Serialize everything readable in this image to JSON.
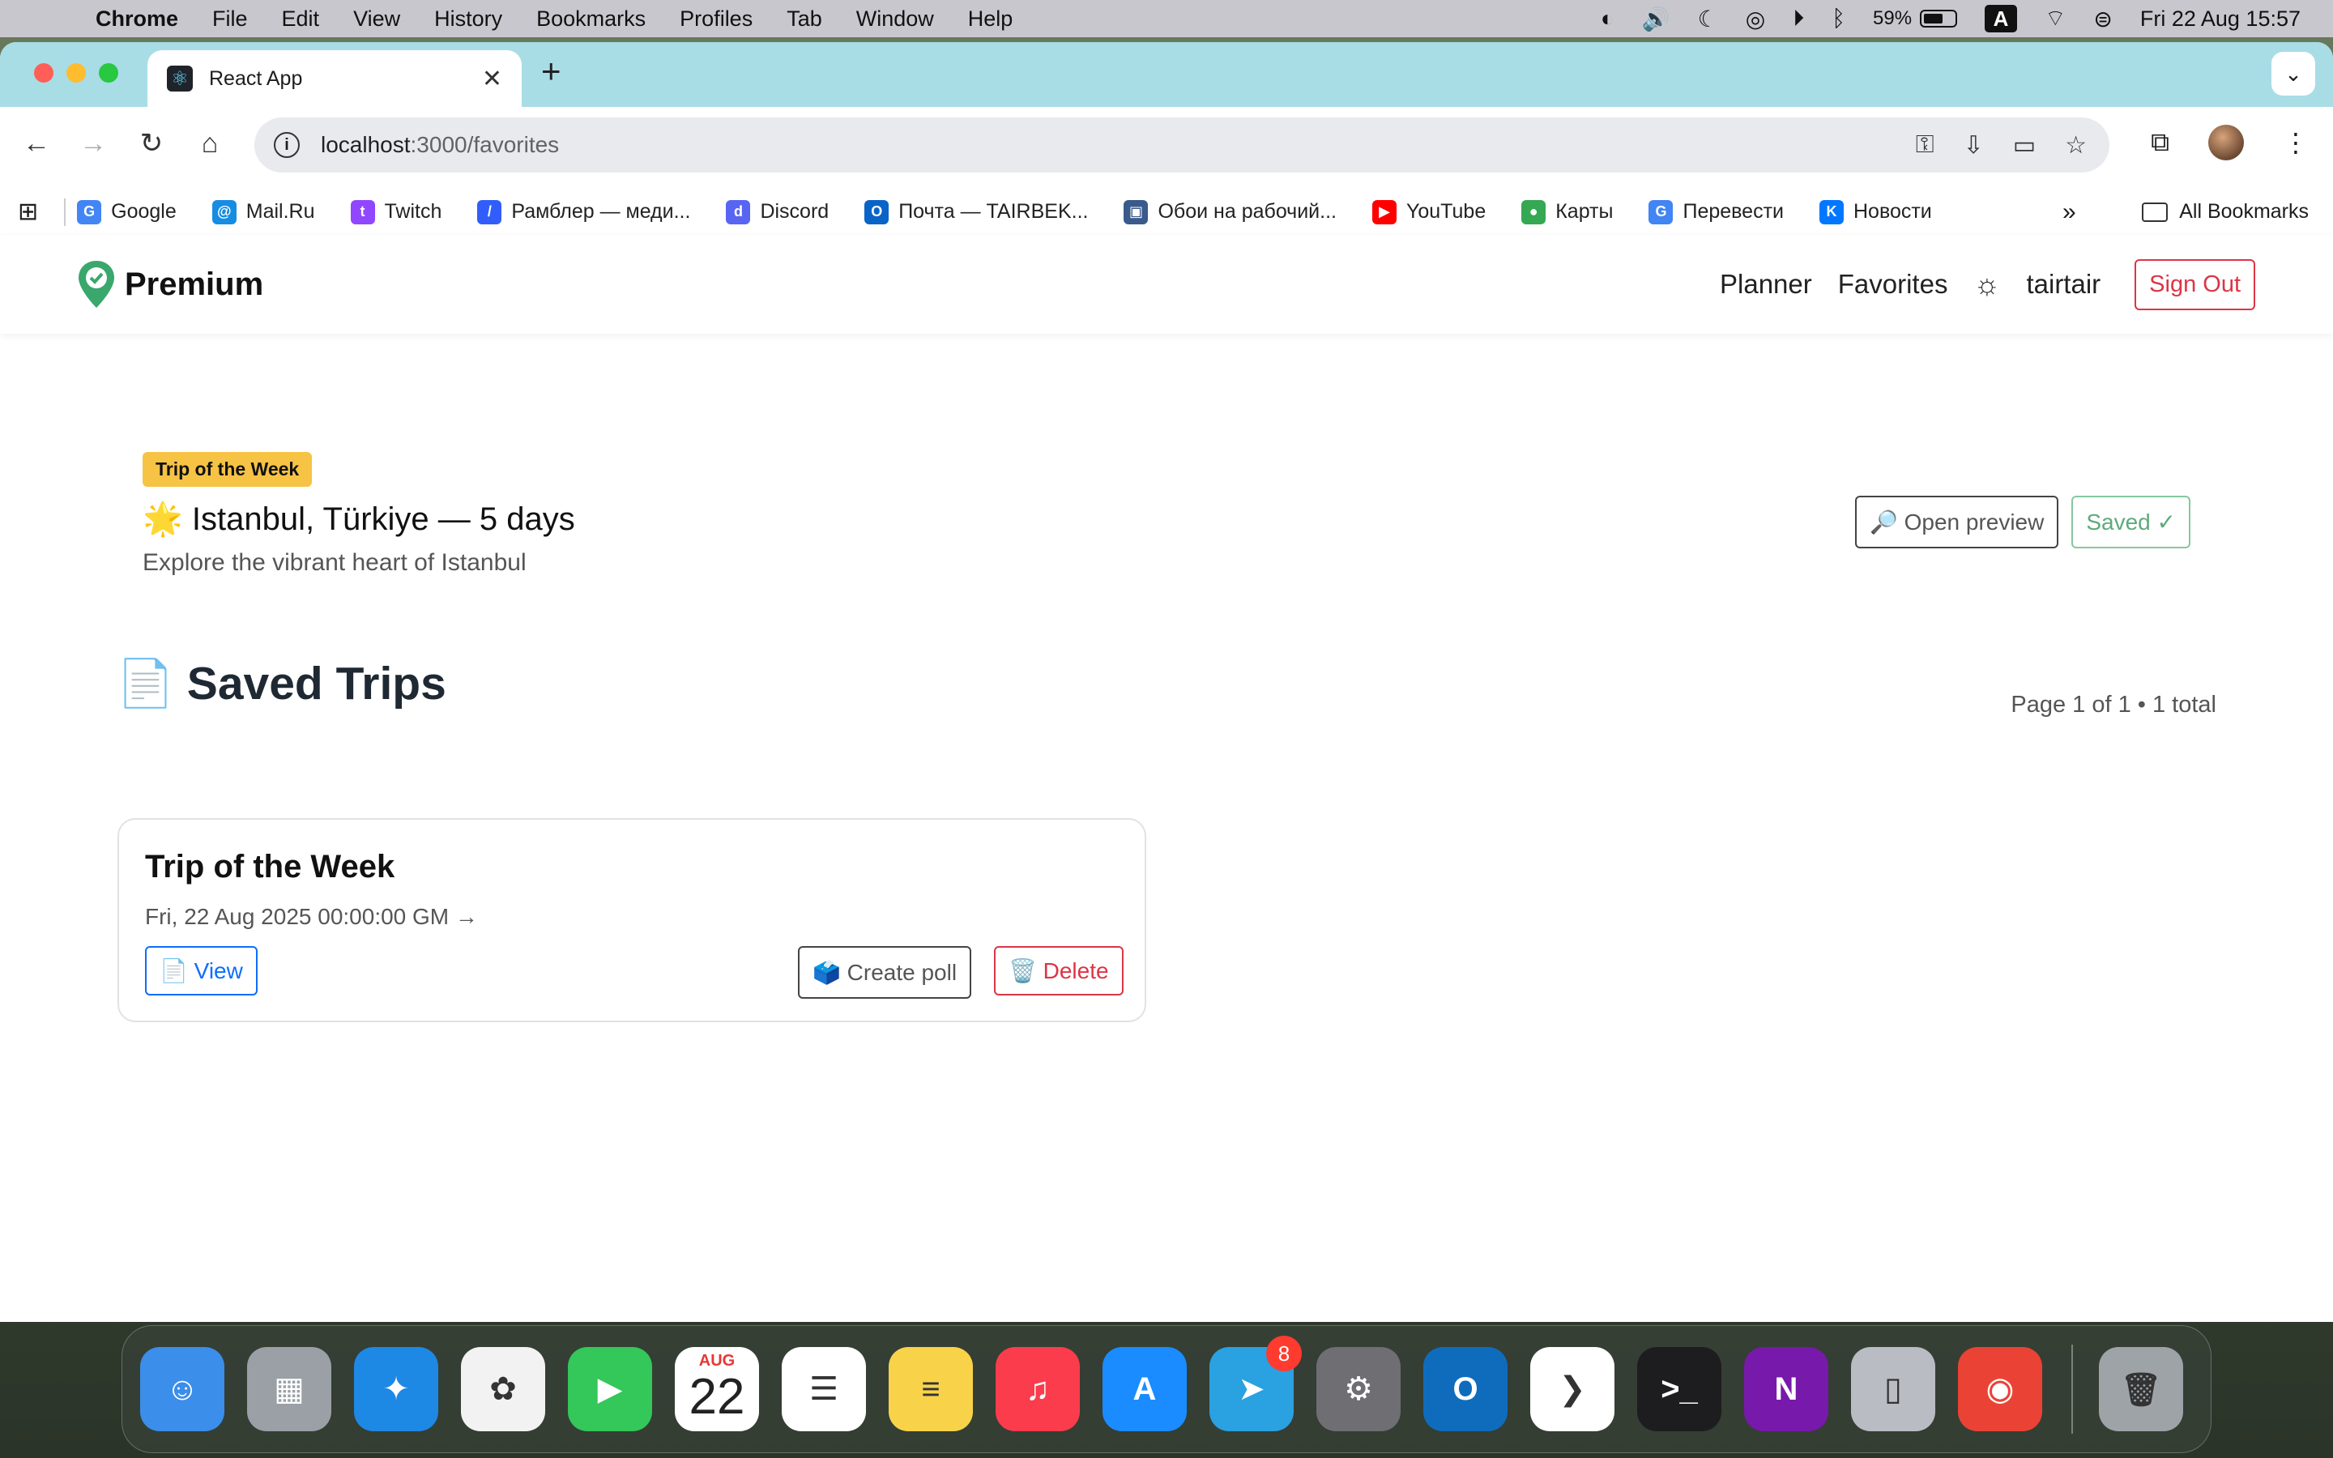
{
  "menubar": {
    "app": "Chrome",
    "items": [
      "File",
      "Edit",
      "View",
      "History",
      "Bookmarks",
      "Profiles",
      "Tab",
      "Window",
      "Help"
    ],
    "battery": "59%",
    "input_source": "A",
    "datetime": "Fri 22 Aug  15:57"
  },
  "browser": {
    "tab_title": "React App",
    "url_host": "localhost",
    "url_path": ":3000/favorites",
    "bookmarks": [
      {
        "label": "Google",
        "icon": "google-icon",
        "color": "#4285f4",
        "glyph": "G"
      },
      {
        "label": "Mail.Ru",
        "icon": "mailru-icon",
        "color": "#168de2",
        "glyph": "@"
      },
      {
        "label": "Twitch",
        "icon": "twitch-icon",
        "color": "#9146ff",
        "glyph": "t"
      },
      {
        "label": "Рамблер — меди...",
        "icon": "rambler-icon",
        "color": "#315efb",
        "glyph": "/"
      },
      {
        "label": "Discord",
        "icon": "discord-icon",
        "color": "#5865f2",
        "glyph": "d"
      },
      {
        "label": "Почта — TAIRBEK...",
        "icon": "outlook-icon",
        "color": "#0a64c8",
        "glyph": "O"
      },
      {
        "label": "Обои на рабочий...",
        "icon": "wallpaper-icon",
        "color": "#3a5a8c",
        "glyph": "▣"
      },
      {
        "label": "YouTube",
        "icon": "youtube-icon",
        "color": "#ff0000",
        "glyph": "▶"
      },
      {
        "label": "Карты",
        "icon": "maps-icon",
        "color": "#34a853",
        "glyph": "●"
      },
      {
        "label": "Перевести",
        "icon": "translate-icon",
        "color": "#4285f4",
        "glyph": "G"
      },
      {
        "label": "Новости",
        "icon": "vk-icon",
        "color": "#0077ff",
        "glyph": "K"
      }
    ],
    "all_bookmarks": "All Bookmarks"
  },
  "app": {
    "brand": "Premium",
    "nav": {
      "planner": "Planner",
      "favorites": "Favorites",
      "username": "tairtair",
      "sign_out": "Sign Out"
    },
    "spotlight": {
      "badge": "Trip of the Week",
      "title": "🌟 Istanbul, Türkiye — 5 days",
      "subtitle": "Explore the vibrant heart of Istanbul",
      "preview_button": "🔎 Open preview",
      "saved_button": "Saved ✓"
    },
    "saved": {
      "title": "📄 Saved Trips",
      "pager": "Page 1 of 1 • 1 total",
      "trips": [
        {
          "title": "Trip of the Week",
          "date": "Fri, 22 Aug 2025 00:00:00 GM →",
          "view": "📄 View",
          "poll": "🗳️ Create poll",
          "delete": "🗑️ Delete"
        }
      ]
    }
  },
  "dock": {
    "apps": [
      {
        "name": "finder-icon",
        "color": "#3b8eea",
        "glyph": "☺"
      },
      {
        "name": "launchpad-icon",
        "color": "#9aa0a6",
        "glyph": "▦"
      },
      {
        "name": "safari-icon",
        "color": "#1e88e5",
        "glyph": "✦"
      },
      {
        "name": "photos-icon",
        "color": "#f2f2f2",
        "glyph": "✿"
      },
      {
        "name": "facetime-icon",
        "color": "#34c759",
        "glyph": "▶"
      },
      {
        "name": "calendar-icon",
        "color": "#ffffff",
        "glyph": ""
      },
      {
        "name": "reminders-icon",
        "color": "#ffffff",
        "glyph": "☰"
      },
      {
        "name": "notes-icon",
        "color": "#f8d34a",
        "glyph": "≡"
      },
      {
        "name": "music-icon",
        "color": "#fa3c4c",
        "glyph": "♫"
      },
      {
        "name": "app-store-icon",
        "color": "#1a8cff",
        "glyph": "A"
      },
      {
        "name": "telegram-icon",
        "color": "#2aa1e0",
        "glyph": "➤",
        "badge": "8"
      },
      {
        "name": "system-settings-icon",
        "color": "#6e6e73",
        "glyph": "⚙"
      },
      {
        "name": "outlook-icon",
        "color": "#0f6cbd",
        "glyph": "O"
      },
      {
        "name": "vscode-icon",
        "color": "#ffffff",
        "glyph": "❯"
      },
      {
        "name": "terminal-icon",
        "color": "#1d1d1f",
        "glyph": ">_"
      },
      {
        "name": "onenote-icon",
        "color": "#7719aa",
        "glyph": "N"
      },
      {
        "name": "iphone-mirroring-icon",
        "color": "#b9bcc2",
        "glyph": "▯"
      },
      {
        "name": "chrome-icon",
        "color": "#ea4335",
        "glyph": "◉"
      }
    ],
    "calendar_month": "AUG",
    "calendar_day": "22",
    "trash": "trash-icon"
  }
}
